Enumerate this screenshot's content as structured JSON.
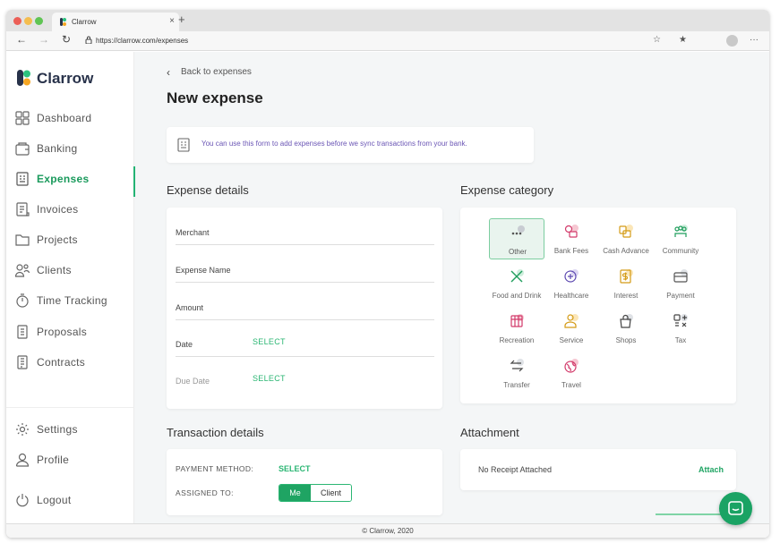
{
  "browser": {
    "tab_title": "Clarrow",
    "tab_close": "×",
    "new_tab": "+",
    "url": "https://clarrow.com/expenses",
    "back": "←",
    "forward": "→",
    "reload": "↻",
    "star": "☆",
    "favorites": "★",
    "more": "···",
    "traffic_lights": [
      "#ec5f57",
      "#f4bd4f",
      "#5fc453"
    ]
  },
  "brand": {
    "name": "Clarrow",
    "colors": {
      "primary": "#24b374",
      "logo_dark": "#28324a",
      "logo_green": "#2bc27e",
      "logo_orange": "#f5a623"
    }
  },
  "sidebar": {
    "items": [
      {
        "label": "Dashboard",
        "icon": "dashboard-icon"
      },
      {
        "label": "Banking",
        "icon": "bank-icon"
      },
      {
        "label": "Expenses",
        "icon": "receipt-icon",
        "active": true
      },
      {
        "label": "Invoices",
        "icon": "invoice-icon"
      },
      {
        "label": "Projects",
        "icon": "folder-icon"
      },
      {
        "label": "Clients",
        "icon": "clients-icon"
      },
      {
        "label": "Time Tracking",
        "icon": "stopwatch-icon"
      },
      {
        "label": "Proposals",
        "icon": "proposal-icon"
      },
      {
        "label": "Contracts",
        "icon": "contract-icon"
      }
    ],
    "bottom": [
      {
        "label": "Settings",
        "icon": "gear-icon"
      },
      {
        "label": "Profile",
        "icon": "user-icon"
      },
      {
        "label": "Logout",
        "icon": "power-icon"
      }
    ]
  },
  "page": {
    "back_link": "Back to expenses",
    "title": "New expense",
    "info": "You can use this form to add expenses before we sync transactions from your bank."
  },
  "expense_details": {
    "title": "Expense details",
    "fields": [
      {
        "label": "Merchant"
      },
      {
        "label": "Expense Name"
      },
      {
        "label": "Amount"
      },
      {
        "label": "Date",
        "action": "SELECT"
      },
      {
        "label": "Due Date",
        "action": "SELECT"
      }
    ]
  },
  "expense_category": {
    "title": "Expense category",
    "categories": [
      {
        "label": "Other",
        "icon": "more-dots-icon",
        "selected": true
      },
      {
        "label": "Bank Fees",
        "icon": "coins-icon"
      },
      {
        "label": "Cash Advance",
        "icon": "cash-stack-icon"
      },
      {
        "label": "Community",
        "icon": "community-icon"
      },
      {
        "label": "Food and Drink",
        "icon": "utensils-icon"
      },
      {
        "label": "Healthcare",
        "icon": "healthcare-icon"
      },
      {
        "label": "Interest",
        "icon": "dollar-doc-icon"
      },
      {
        "label": "Payment",
        "icon": "card-icon"
      },
      {
        "label": "Recreation",
        "icon": "recreation-icon"
      },
      {
        "label": "Service",
        "icon": "service-person-icon"
      },
      {
        "label": "Shops",
        "icon": "shopping-bag-icon"
      },
      {
        "label": "Tax",
        "icon": "tax-icon"
      },
      {
        "label": "Transfer",
        "icon": "transfer-arrows-icon"
      },
      {
        "label": "Travel",
        "icon": "globe-icon"
      }
    ]
  },
  "transaction_details": {
    "title": "Transaction details",
    "payment_method_label": "PAYMENT METHOD:",
    "payment_method_value": "SELECT",
    "assigned_to_label": "ASSIGNED TO:",
    "assigned_options": [
      "Me",
      "Client"
    ],
    "assigned_selected": "Me"
  },
  "attachment": {
    "title": "Attachment",
    "status": "No Receipt Attached",
    "action": "Attach"
  },
  "footer": {
    "text": "© Clarrow, 2020"
  }
}
